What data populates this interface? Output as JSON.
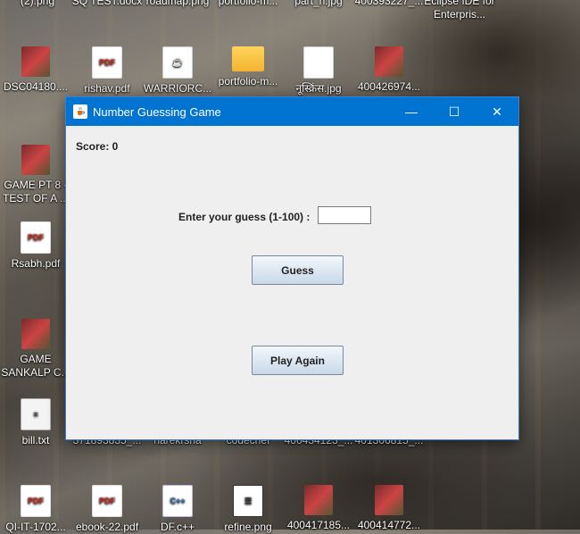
{
  "desktop": {
    "icons": [
      {
        "label": "(2).png",
        "type": "img"
      },
      {
        "label": "SQ TEST.docx",
        "type": "doc"
      },
      {
        "label": "roadmap.png",
        "type": "img"
      },
      {
        "label": "portfolio-m...",
        "type": "img"
      },
      {
        "label": "part_ri.jpg",
        "type": "img"
      },
      {
        "label": "400393227_...",
        "type": "img"
      },
      {
        "label": "Eclipse IDE for Enterpris...",
        "type": "img"
      },
      {
        "label": "DSC04180....",
        "type": "img"
      },
      {
        "label": "rishav.pdf",
        "type": "pdf"
      },
      {
        "label": "WARRIORC...",
        "type": "doc"
      },
      {
        "label": "portfolio-m...",
        "type": "folder"
      },
      {
        "label": "नूस्क्रिंस.jpg",
        "type": "img"
      },
      {
        "label": "400426974...",
        "type": "img"
      },
      {
        "label": "GAME PT 8 - TEST OF A ...",
        "type": "img"
      },
      {
        "label": "Rsabh.pdf",
        "type": "pdf"
      },
      {
        "label": "GAME SANKALP C...",
        "type": "img"
      },
      {
        "label": "bill.txt",
        "type": "txt"
      },
      {
        "label": "371893835_...",
        "type": "img"
      },
      {
        "label": "harekrsha",
        "type": "img"
      },
      {
        "label": "codechef",
        "type": "img"
      },
      {
        "label": "400434123_...",
        "type": "img"
      },
      {
        "label": "401306815_...",
        "type": "img"
      },
      {
        "label": "QI-IT-1702...",
        "type": "pdf"
      },
      {
        "label": "ebook-22.pdf",
        "type": "pdf"
      },
      {
        "label": "DF.c++",
        "type": "cpp"
      },
      {
        "label": "refine.png",
        "type": "set"
      },
      {
        "label": "400417185...",
        "type": "img"
      },
      {
        "label": "400414772...",
        "type": "img"
      }
    ]
  },
  "window": {
    "title": "Number Guessing Game",
    "minimize": "—",
    "maximize": "☐",
    "close": "✕"
  },
  "game": {
    "score_text": "Score: 0",
    "guess_prompt": "Enter your guess (1-100) :",
    "guess_value": "",
    "guess_button": "Guess",
    "play_again_button": "Play Again"
  }
}
